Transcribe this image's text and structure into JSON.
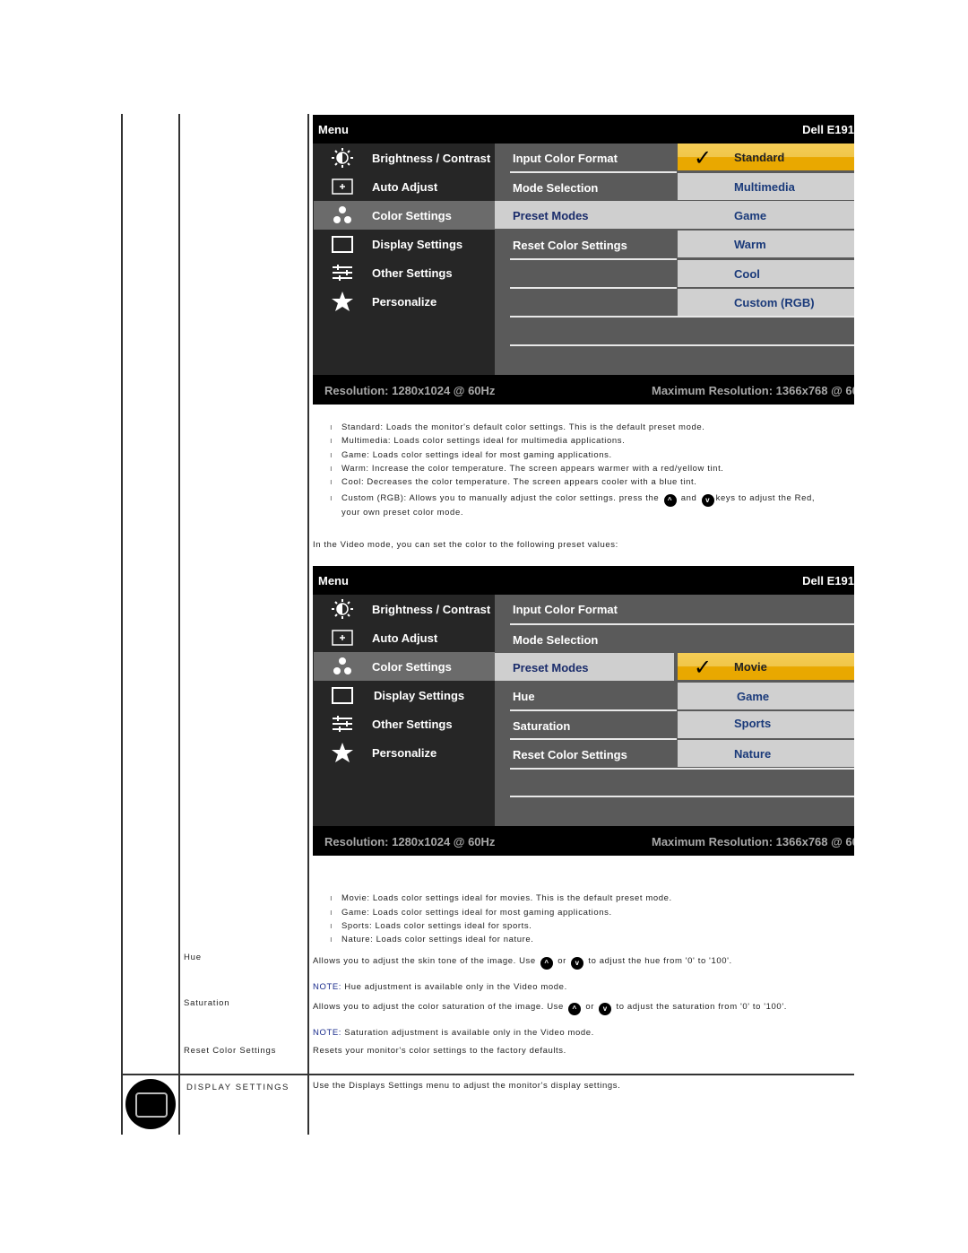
{
  "osd_standard": {
    "header_left": "Menu",
    "header_right": "Dell E191",
    "left_menu": [
      {
        "label": "Brightness / Contrast",
        "icon": "brightness-icon"
      },
      {
        "label": "Auto Adjust",
        "icon": "auto-adjust-icon"
      },
      {
        "label": "Color Settings",
        "icon": "color-settings-icon",
        "selected": true
      },
      {
        "label": "Display Settings",
        "icon": "display-settings-icon"
      },
      {
        "label": "Other Settings",
        "icon": "other-settings-icon"
      },
      {
        "label": "Personalize",
        "icon": "star-icon"
      }
    ],
    "middle_menu": [
      "Input Color Format",
      "Mode Selection",
      "Preset Modes",
      "Reset Color Settings"
    ],
    "middle_selected": "Preset Modes",
    "right_menu": [
      "Standard",
      "Multimedia",
      "Game",
      "Warm",
      "Cool",
      "Custom (RGB)"
    ],
    "right_selected": "Standard",
    "footer_left": "Resolution: 1280x1024 @ 60Hz",
    "footer_right": "Maximum Resolution: 1366x768 @ 60"
  },
  "standard_bullets": [
    "Standard: Loads the monitor's default color settings. This is the default preset mode.",
    "Multimedia: Loads color settings ideal for multimedia applications.",
    "Game: Loads color settings ideal for most gaming applications.",
    "Warm: Increase the color temperature. The screen appears warmer with a red/yellow tint.",
    "Cool: Decreases the color temperature. The screen appears cooler with a blue tint."
  ],
  "custom_bullet": {
    "part1": "Custom (RGB): Allows you to manually adjust the color settings. press the",
    "and": "and",
    "part2": "keys to adjust the Red,",
    "line2": "your own preset color mode."
  },
  "video_intro": "In the Video mode, you can set the color to the following preset values:",
  "osd_video": {
    "header_left": "Menu",
    "header_right": "Dell E191",
    "left_menu": [
      {
        "label": "Brightness / Contrast"
      },
      {
        "label": "Auto Adjust"
      },
      {
        "label": "Color Settings",
        "selected": true
      },
      {
        "label": "Display Settings"
      },
      {
        "label": "Other Settings"
      },
      {
        "label": "Personalize"
      }
    ],
    "middle_menu": [
      "Input Color Format",
      "Mode Selection",
      "Preset Modes",
      "Hue",
      "Saturation",
      "Reset Color Settings"
    ],
    "middle_selected": "Preset Modes",
    "right_menu": [
      "Movie",
      "Game",
      "Sports",
      "Nature"
    ],
    "right_selected": "Movie",
    "footer_left": "Resolution: 1280x1024 @ 60Hz",
    "footer_right": "Maximum Resolution: 1366x768 @ 60"
  },
  "video_bullets": [
    "Movie: Loads color settings ideal for movies. This is the default preset mode.",
    "Game: Loads color settings ideal for most gaming applications.",
    "Sports: Loads color settings ideal for sports.",
    "Nature: Loads color settings ideal for nature."
  ],
  "rows": {
    "hue": {
      "label": "Hue",
      "desc1": "Allows you to adjust the skin tone of the image. Use",
      "or": "or",
      "desc2": "to adjust the hue from '0' to '100'.",
      "note_label": "NOTE:",
      "note": "Hue adjustment is available only in the Video mode."
    },
    "saturation": {
      "label": "Saturation",
      "desc1": "Allows you to adjust the color saturation of the image. Use",
      "or": "or",
      "desc2": "to adjust the saturation from '0' to '100'.",
      "note_label": "NOTE:",
      "note": "Saturation adjustment is available only in the Video mode."
    },
    "reset": {
      "label": "Reset Color Settings",
      "desc": "Resets your monitor's color settings to the factory defaults."
    },
    "display": {
      "label": "DISPLAY SETTINGS",
      "desc": "Use the Displays Settings menu to adjust the monitor's display settings."
    }
  },
  "key_up": "^",
  "key_down": "v",
  "bullet_glyph": "ı",
  "check_glyph": "✓"
}
